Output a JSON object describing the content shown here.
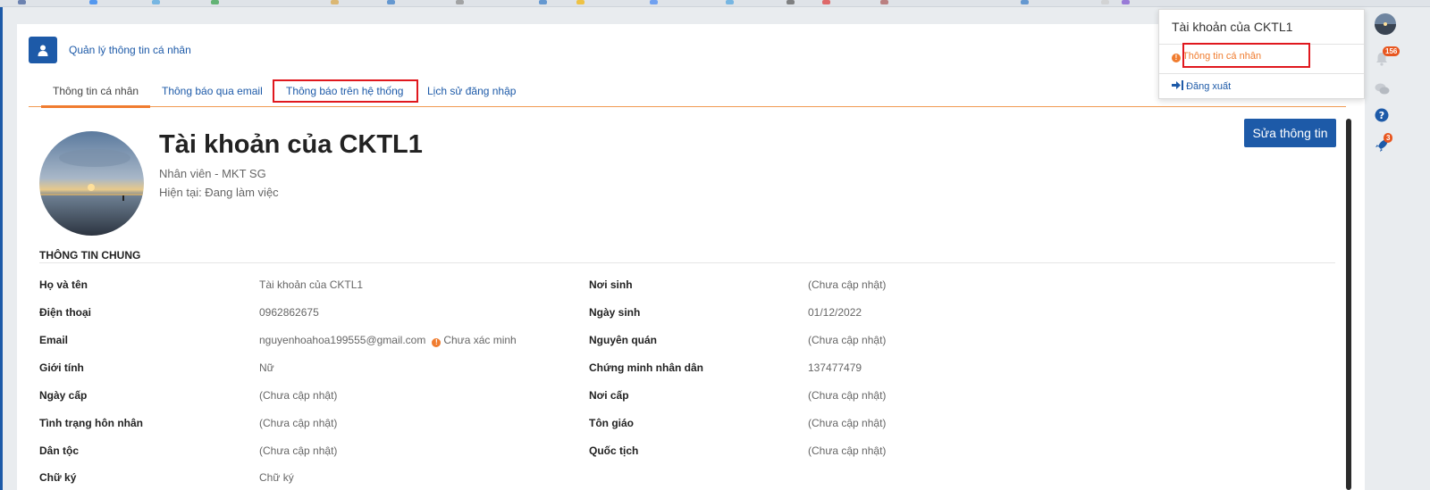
{
  "header": {
    "title": "Quản lý thông tin cá nhân"
  },
  "tabs": [
    {
      "label": "Thông tin cá nhân",
      "active": true
    },
    {
      "label": "Thông báo qua email",
      "active": false
    },
    {
      "label": "Thông báo trên hệ thống",
      "active": false
    },
    {
      "label": "Lịch sử đăng nhập",
      "active": false
    }
  ],
  "profile": {
    "name": "Tài khoản của CKTL1",
    "role": "Nhân viên - MKT SG",
    "status": "Hiện tại: Đang làm việc",
    "edit_label": "Sửa thông tin"
  },
  "section": {
    "title": "THÔNG TIN CHUNG"
  },
  "fields_left": [
    {
      "label": "Họ và tên",
      "value": "Tài khoản của CKTL1"
    },
    {
      "label": "Điện thoại",
      "value": "0962862675"
    },
    {
      "label": "Email",
      "value": "nguyenhoahoa199555@gmail.com",
      "note": "Chưa xác minh"
    },
    {
      "label": "Giới tính",
      "value": "Nữ"
    },
    {
      "label": "Ngày cấp",
      "value": "(Chưa cập nhật)"
    },
    {
      "label": "Tình trạng hôn nhân",
      "value": "(Chưa cập nhật)"
    },
    {
      "label": "Dân tộc",
      "value": "(Chưa cập nhật)"
    },
    {
      "label": "Chữ ký",
      "value": "Chữ ký"
    }
  ],
  "fields_right": [
    {
      "label": "Nơi sinh",
      "value": "(Chưa cập nhật)"
    },
    {
      "label": "Ngày sinh",
      "value": "01/12/2022"
    },
    {
      "label": "Nguyên quán",
      "value": "(Chưa cập nhật)"
    },
    {
      "label": "Chứng minh nhân dân",
      "value": "137477479"
    },
    {
      "label": "Nơi cấp",
      "value": "(Chưa cập nhật)"
    },
    {
      "label": "Tôn giáo",
      "value": "(Chưa cập nhật)"
    },
    {
      "label": "Quốc tịch",
      "value": "(Chưa cập nhật)"
    }
  ],
  "dropdown": {
    "title": "Tài khoản của CKTL1",
    "profile_link": "Thông tin cá nhân",
    "logout": "Đăng xuất"
  },
  "right_sidebar": {
    "notification_count": "156",
    "rocket_count": "3"
  },
  "colors": {
    "primary": "#1d5aa8",
    "accent": "#f07c2f",
    "highlight_box": "#e0181e"
  },
  "icons": [
    "user-icon",
    "info-icon",
    "sign-out-icon",
    "bell-icon",
    "comments-icon",
    "question-icon",
    "rocket-icon"
  ]
}
